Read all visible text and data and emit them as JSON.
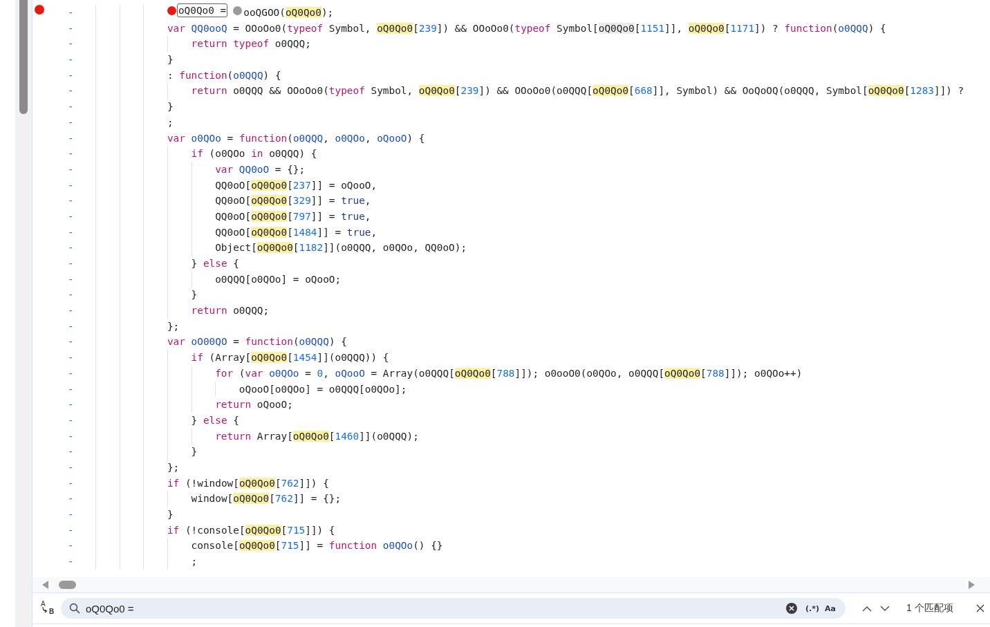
{
  "editor": {
    "lines": [
      {
        "breakpoint": true,
        "marker": "-",
        "segments": [
          {
            "kind": "bp-on"
          },
          {
            "kind": "c",
            "text": "oQ0Qo0 ="
          },
          {
            "kind": "bp-off"
          },
          {
            "kind": "t",
            "text": "ooQGOO("
          },
          {
            "kind": "m",
            "text": "oQ0Qo0"
          },
          {
            "kind": "t",
            "text": ");"
          }
        ]
      },
      {
        "breakpoint": false,
        "marker": "-",
        "segments": [
          {
            "kind": "k",
            "text": "var "
          },
          {
            "kind": "d",
            "text": "QQ0ooQ"
          },
          {
            "kind": "t",
            "text": " = OOoOo0("
          },
          {
            "kind": "k",
            "text": "typeof"
          },
          {
            "kind": "t",
            "text": " Symbol, "
          },
          {
            "kind": "m",
            "text": "oQ0Qo0"
          },
          {
            "kind": "t",
            "text": "["
          },
          {
            "kind": "n",
            "text": "239"
          },
          {
            "kind": "t",
            "text": "]) && OOoOo0("
          },
          {
            "kind": "k",
            "text": "typeof"
          },
          {
            "kind": "t",
            "text": " Symbol["
          },
          {
            "kind": "h",
            "text": "oQ0Qo0"
          },
          {
            "kind": "t",
            "text": "["
          },
          {
            "kind": "n",
            "text": "1151"
          },
          {
            "kind": "t",
            "text": "]], "
          },
          {
            "kind": "m",
            "text": "oQ0Qo0"
          },
          {
            "kind": "t",
            "text": "["
          },
          {
            "kind": "n",
            "text": "1171"
          },
          {
            "kind": "t",
            "text": "]) ? "
          },
          {
            "kind": "k",
            "text": "function"
          },
          {
            "kind": "t",
            "text": "("
          },
          {
            "kind": "d",
            "text": "o0QQQ"
          },
          {
            "kind": "t",
            "text": ") {"
          }
        ],
        "children": [
          {
            "breakpoint": false,
            "marker": "-",
            "segments": [
              {
                "kind": "k",
                "text": "return typeof"
              },
              {
                "kind": "t",
                "text": " o0QQQ;"
              }
            ]
          }
        ]
      },
      {
        "breakpoint": false,
        "marker": "-",
        "segments": [
          {
            "kind": "t",
            "text": "}"
          }
        ]
      },
      {
        "breakpoint": false,
        "marker": "-",
        "segments": [
          {
            "kind": "t",
            "text": ": "
          },
          {
            "kind": "k",
            "text": "function"
          },
          {
            "kind": "t",
            "text": "("
          },
          {
            "kind": "d",
            "text": "o0QQQ"
          },
          {
            "kind": "t",
            "text": ") {"
          }
        ],
        "children": [
          {
            "breakpoint": false,
            "marker": "-",
            "segments": [
              {
                "kind": "k",
                "text": "return"
              },
              {
                "kind": "t",
                "text": " o0QQQ && OOoOo0("
              },
              {
                "kind": "k",
                "text": "typeof"
              },
              {
                "kind": "t",
                "text": " Symbol, "
              },
              {
                "kind": "m",
                "text": "oQ0Qo0"
              },
              {
                "kind": "t",
                "text": "["
              },
              {
                "kind": "n",
                "text": "239"
              },
              {
                "kind": "t",
                "text": "]) && OOoOo0(o0QQQ["
              },
              {
                "kind": "m",
                "text": "oQ0Qo0"
              },
              {
                "kind": "t",
                "text": "["
              },
              {
                "kind": "n",
                "text": "668"
              },
              {
                "kind": "t",
                "text": "]], Symbol) && OoQoOQ(o0QQQ, Symbol["
              },
              {
                "kind": "m",
                "text": "oQ0Qo0"
              },
              {
                "kind": "t",
                "text": "["
              },
              {
                "kind": "n",
                "text": "1283"
              },
              {
                "kind": "t",
                "text": "]]) ?"
              }
            ]
          }
        ]
      },
      {
        "breakpoint": false,
        "marker": "-",
        "segments": [
          {
            "kind": "t",
            "text": "}"
          }
        ]
      },
      {
        "breakpoint": false,
        "marker": "-",
        "segments": [
          {
            "kind": "t",
            "text": ";"
          }
        ]
      },
      {
        "breakpoint": false,
        "marker": "-",
        "segments": [
          {
            "kind": "k",
            "text": "var "
          },
          {
            "kind": "d",
            "text": "o0QOo"
          },
          {
            "kind": "t",
            "text": " = "
          },
          {
            "kind": "k",
            "text": "function"
          },
          {
            "kind": "t",
            "text": "("
          },
          {
            "kind": "d",
            "text": "o0QQQ"
          },
          {
            "kind": "t",
            "text": ", "
          },
          {
            "kind": "d",
            "text": "o0QOo"
          },
          {
            "kind": "t",
            "text": ", "
          },
          {
            "kind": "d",
            "text": "oQooO"
          },
          {
            "kind": "t",
            "text": ") {"
          }
        ],
        "children": [
          {
            "breakpoint": false,
            "marker": "-",
            "segments": [
              {
                "kind": "k",
                "text": "if"
              },
              {
                "kind": "t",
                "text": " (o0QOo "
              },
              {
                "kind": "k",
                "text": "in"
              },
              {
                "kind": "t",
                "text": " o0QQQ) {"
              }
            ],
            "children": [
              {
                "breakpoint": false,
                "marker": "-",
                "segments": [
                  {
                    "kind": "k",
                    "text": "var "
                  },
                  {
                    "kind": "d",
                    "text": "QQ0oO"
                  },
                  {
                    "kind": "t",
                    "text": " = {};"
                  }
                ]
              },
              {
                "breakpoint": false,
                "marker": "-",
                "segments": [
                  {
                    "kind": "t",
                    "text": "QQ0oO["
                  },
                  {
                    "kind": "m",
                    "text": "oQ0Qo0"
                  },
                  {
                    "kind": "t",
                    "text": "["
                  },
                  {
                    "kind": "n",
                    "text": "237"
                  },
                  {
                    "kind": "t",
                    "text": "]] = oQooO,"
                  }
                ]
              },
              {
                "breakpoint": false,
                "marker": "-",
                "segments": [
                  {
                    "kind": "t",
                    "text": "QQ0oO["
                  },
                  {
                    "kind": "m",
                    "text": "oQ0Qo0"
                  },
                  {
                    "kind": "t",
                    "text": "["
                  },
                  {
                    "kind": "n",
                    "text": "329"
                  },
                  {
                    "kind": "t",
                    "text": "]] = "
                  },
                  {
                    "kind": "l",
                    "text": "true"
                  },
                  {
                    "kind": "t",
                    "text": ","
                  }
                ]
              },
              {
                "breakpoint": false,
                "marker": "-",
                "segments": [
                  {
                    "kind": "t",
                    "text": "QQ0oO["
                  },
                  {
                    "kind": "m",
                    "text": "oQ0Qo0"
                  },
                  {
                    "kind": "t",
                    "text": "["
                  },
                  {
                    "kind": "n",
                    "text": "797"
                  },
                  {
                    "kind": "t",
                    "text": "]] = "
                  },
                  {
                    "kind": "l",
                    "text": "true"
                  },
                  {
                    "kind": "t",
                    "text": ","
                  }
                ]
              },
              {
                "breakpoint": false,
                "marker": "-",
                "segments": [
                  {
                    "kind": "t",
                    "text": "QQ0oO["
                  },
                  {
                    "kind": "m",
                    "text": "oQ0Qo0"
                  },
                  {
                    "kind": "t",
                    "text": "["
                  },
                  {
                    "kind": "n",
                    "text": "1484"
                  },
                  {
                    "kind": "t",
                    "text": "]] = "
                  },
                  {
                    "kind": "l",
                    "text": "true"
                  },
                  {
                    "kind": "t",
                    "text": ","
                  }
                ]
              },
              {
                "breakpoint": false,
                "marker": "-",
                "segments": [
                  {
                    "kind": "t",
                    "text": "Object["
                  },
                  {
                    "kind": "m",
                    "text": "oQ0Qo0"
                  },
                  {
                    "kind": "t",
                    "text": "["
                  },
                  {
                    "kind": "n",
                    "text": "1182"
                  },
                  {
                    "kind": "t",
                    "text": "]](o0QQQ, o0QOo, QQ0oO);"
                  }
                ]
              }
            ]
          },
          {
            "breakpoint": false,
            "marker": "-",
            "segments": [
              {
                "kind": "t",
                "text": "} "
              },
              {
                "kind": "k",
                "text": "else"
              },
              {
                "kind": "t",
                "text": " {"
              }
            ],
            "children": [
              {
                "breakpoint": false,
                "marker": "-",
                "segments": [
                  {
                    "kind": "t",
                    "text": "o0QQQ[o0QOo] = oQooO;"
                  }
                ]
              }
            ]
          },
          {
            "breakpoint": false,
            "marker": "-",
            "segments": [
              {
                "kind": "t",
                "text": "}"
              }
            ]
          },
          {
            "breakpoint": false,
            "marker": "-",
            "segments": [
              {
                "kind": "k",
                "text": "return"
              },
              {
                "kind": "t",
                "text": " o0QQQ;"
              }
            ]
          }
        ]
      },
      {
        "breakpoint": false,
        "marker": "-",
        "segments": [
          {
            "kind": "t",
            "text": "};"
          }
        ]
      },
      {
        "breakpoint": false,
        "marker": "-",
        "segments": [
          {
            "kind": "k",
            "text": "var "
          },
          {
            "kind": "d",
            "text": "oO00QO"
          },
          {
            "kind": "t",
            "text": " = "
          },
          {
            "kind": "k",
            "text": "function"
          },
          {
            "kind": "t",
            "text": "("
          },
          {
            "kind": "d",
            "text": "o0QQQ"
          },
          {
            "kind": "t",
            "text": ") {"
          }
        ],
        "children": [
          {
            "breakpoint": false,
            "marker": "-",
            "segments": [
              {
                "kind": "k",
                "text": "if"
              },
              {
                "kind": "t",
                "text": " (Array["
              },
              {
                "kind": "m",
                "text": "oQ0Qo0"
              },
              {
                "kind": "t",
                "text": "["
              },
              {
                "kind": "n",
                "text": "1454"
              },
              {
                "kind": "t",
                "text": "]](o0QQQ)) {"
              }
            ],
            "children": [
              {
                "breakpoint": false,
                "marker": "-",
                "segments": [
                  {
                    "kind": "k",
                    "text": "for"
                  },
                  {
                    "kind": "t",
                    "text": " ("
                  },
                  {
                    "kind": "k",
                    "text": "var "
                  },
                  {
                    "kind": "d",
                    "text": "o0QOo"
                  },
                  {
                    "kind": "t",
                    "text": " = "
                  },
                  {
                    "kind": "n",
                    "text": "0"
                  },
                  {
                    "kind": "t",
                    "text": ", "
                  },
                  {
                    "kind": "d",
                    "text": "oQooO"
                  },
                  {
                    "kind": "t",
                    "text": " = Array(o0QQQ["
                  },
                  {
                    "kind": "m",
                    "text": "oQ0Qo0"
                  },
                  {
                    "kind": "t",
                    "text": "["
                  },
                  {
                    "kind": "n",
                    "text": "788"
                  },
                  {
                    "kind": "t",
                    "text": "]]); o0ooO0(o0QOo, o0QQQ["
                  },
                  {
                    "kind": "m",
                    "text": "oQ0Qo0"
                  },
                  {
                    "kind": "t",
                    "text": "["
                  },
                  {
                    "kind": "n",
                    "text": "788"
                  },
                  {
                    "kind": "t",
                    "text": "]]); o0QOo++)"
                  }
                ],
                "children": [
                  {
                    "breakpoint": false,
                    "marker": "-",
                    "segments": [
                      {
                        "kind": "t",
                        "text": "oQooO[o0QOo] = o0QQQ[o0QOo];"
                      }
                    ]
                  }
                ]
              },
              {
                "breakpoint": false,
                "marker": "-",
                "segments": [
                  {
                    "kind": "k",
                    "text": "return"
                  },
                  {
                    "kind": "t",
                    "text": " oQooO;"
                  }
                ]
              }
            ]
          },
          {
            "breakpoint": false,
            "marker": "-",
            "segments": [
              {
                "kind": "t",
                "text": "} "
              },
              {
                "kind": "k",
                "text": "else"
              },
              {
                "kind": "t",
                "text": " {"
              }
            ],
            "children": [
              {
                "breakpoint": false,
                "marker": "-",
                "segments": [
                  {
                    "kind": "k",
                    "text": "return"
                  },
                  {
                    "kind": "t",
                    "text": " Array["
                  },
                  {
                    "kind": "m",
                    "text": "oQ0Qo0"
                  },
                  {
                    "kind": "t",
                    "text": "["
                  },
                  {
                    "kind": "n",
                    "text": "1460"
                  },
                  {
                    "kind": "t",
                    "text": "]](o0QQQ);"
                  }
                ]
              }
            ]
          },
          {
            "breakpoint": false,
            "marker": "-",
            "segments": [
              {
                "kind": "t",
                "text": "}"
              }
            ]
          }
        ]
      },
      {
        "breakpoint": false,
        "marker": "-",
        "segments": [
          {
            "kind": "t",
            "text": "};"
          }
        ]
      },
      {
        "breakpoint": false,
        "marker": "-",
        "segments": [
          {
            "kind": "k",
            "text": "if"
          },
          {
            "kind": "t",
            "text": " (!window["
          },
          {
            "kind": "m",
            "text": "oQ0Qo0"
          },
          {
            "kind": "t",
            "text": "["
          },
          {
            "kind": "n",
            "text": "762"
          },
          {
            "kind": "t",
            "text": "]]) {"
          }
        ],
        "children": [
          {
            "breakpoint": false,
            "marker": "-",
            "segments": [
              {
                "kind": "t",
                "text": "window["
              },
              {
                "kind": "m",
                "text": "oQ0Qo0"
              },
              {
                "kind": "t",
                "text": "["
              },
              {
                "kind": "n",
                "text": "762"
              },
              {
                "kind": "t",
                "text": "]] = {};"
              }
            ]
          }
        ]
      },
      {
        "breakpoint": false,
        "marker": "-",
        "segments": [
          {
            "kind": "t",
            "text": "}"
          }
        ]
      },
      {
        "breakpoint": false,
        "marker": "-",
        "segments": [
          {
            "kind": "k",
            "text": "if"
          },
          {
            "kind": "t",
            "text": " (!console["
          },
          {
            "kind": "m",
            "text": "oQ0Qo0"
          },
          {
            "kind": "t",
            "text": "["
          },
          {
            "kind": "n",
            "text": "715"
          },
          {
            "kind": "t",
            "text": "]]) {"
          }
        ],
        "children": [
          {
            "breakpoint": false,
            "marker": "-",
            "segments": [
              {
                "kind": "t",
                "text": "console["
              },
              {
                "kind": "m",
                "text": "oQ0Qo0"
              },
              {
                "kind": "t",
                "text": "["
              },
              {
                "kind": "n",
                "text": "715"
              },
              {
                "kind": "t",
                "text": "]] = "
              },
              {
                "kind": "k",
                "text": "function "
              },
              {
                "kind": "d",
                "text": "o0QOo"
              },
              {
                "kind": "t",
                "text": "() {}"
              }
            ]
          },
          {
            "breakpoint": false,
            "marker": "-",
            "segments": [
              {
                "kind": "t",
                "text": ";"
              }
            ]
          }
        ]
      }
    ]
  },
  "search_bar": {
    "replace_labels": [
      "A",
      "B"
    ],
    "query": "oQ0Qo0 =",
    "regex_label": "(.*)",
    "case_label": "Aa",
    "match_count": "1 个匹配项"
  }
}
